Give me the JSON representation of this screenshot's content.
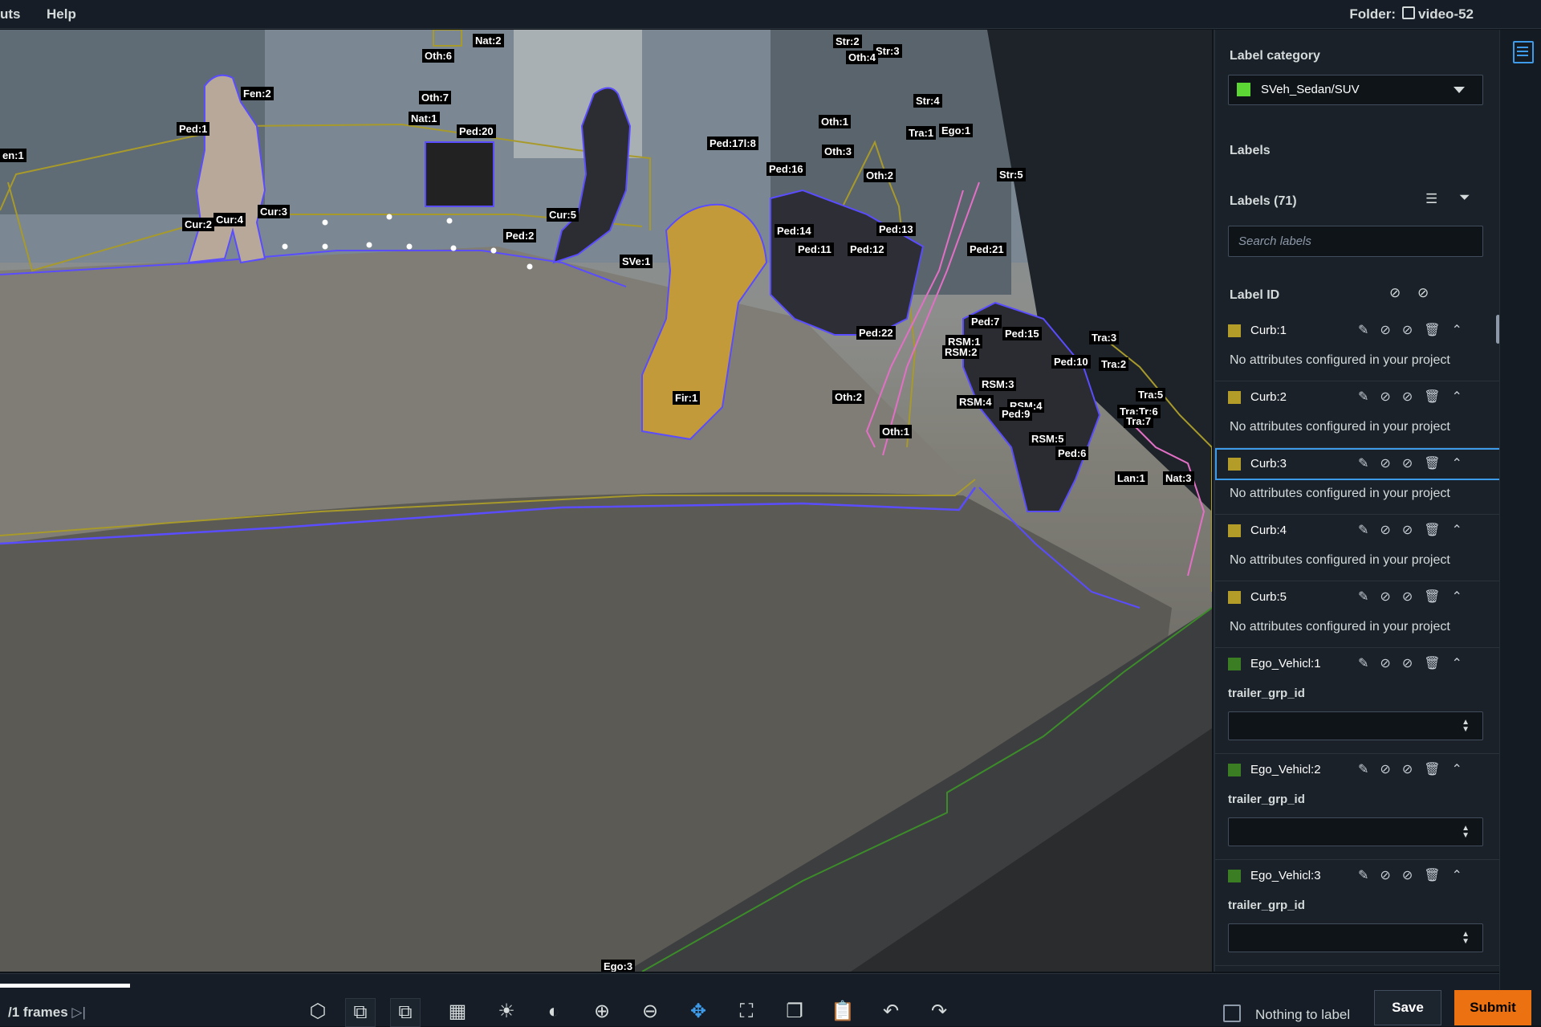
{
  "topbar": {
    "menus": [
      "uts",
      "Help"
    ],
    "folder_label": "Folder:",
    "folder_name": "video-52"
  },
  "canvas": {
    "labels": [
      "en:1",
      "Fen:2",
      "Ped:1",
      "Cur:2",
      "Cur:4",
      "Cur:3",
      "Oth:6",
      "Nat:2",
      "Oth:7",
      "Nat:1",
      "Ped:20",
      "Ped:2",
      "Cur:5",
      "SVe:1",
      "Ped:17l:8",
      "Ped:16",
      "Str:2",
      "Str:3",
      "Oth:4",
      "Str:4",
      "Oth:1",
      "Tra:1",
      "Ego:1",
      "Oth:3",
      "Oth:2",
      "Str:5",
      "Ped:14",
      "Ped:11",
      "Ped:12",
      "Ped:13",
      "Ped:21",
      "Ped:22",
      "Ped:7",
      "RSM:1",
      "RSM:2",
      "Ped:15",
      "Tra:3",
      "Ped:10",
      "Tra:2",
      "RSM:3",
      "RSM:4",
      "RSM:4",
      "Ped:9",
      "Oth:2",
      "Fir:1",
      "Oth:1",
      "RSM:5",
      "Tra:5",
      "Tra:Tr:6",
      "Tra:7",
      "Ped:6",
      "Lan:1",
      "Nat:3",
      "Ego:3"
    ]
  },
  "panel": {
    "category_heading": "Label category",
    "category_value": "SVeh_Sedan/SUV",
    "category_color": "#5cd635",
    "labels_heading": "Labels",
    "labels_count": "Labels (71)",
    "search_placeholder": "Search labels",
    "label_id_heading": "Label ID",
    "no_attr_text": "No attributes configured in your project",
    "attr_field": "trailer_grp_id",
    "rows": [
      {
        "name": "Curb:1",
        "color": "#b39d28"
      },
      {
        "name": "Curb:2",
        "color": "#b39d28"
      },
      {
        "name": "Curb:3",
        "color": "#b39d28"
      },
      {
        "name": "Curb:4",
        "color": "#b39d28"
      },
      {
        "name": "Curb:5",
        "color": "#b39d28"
      },
      {
        "name": "Ego_Vehicl:1",
        "color": "#3a7d22"
      },
      {
        "name": "Ego_Vehicl:2",
        "color": "#3a7d22"
      },
      {
        "name": "Ego_Vehicl:3",
        "color": "#3a7d22"
      }
    ]
  },
  "bottombar": {
    "frames": "/1 frames",
    "nothing_label": "Nothing to label",
    "save": "Save",
    "submit": "Submit"
  },
  "colors": {
    "accent": "#3d9be9",
    "submit": "#ec7211",
    "curb_outline": "#a89a2a",
    "person_outline": "#5a4cff",
    "ego_outline": "#3c8c2a",
    "traffic_outline": "#e36fc6"
  }
}
